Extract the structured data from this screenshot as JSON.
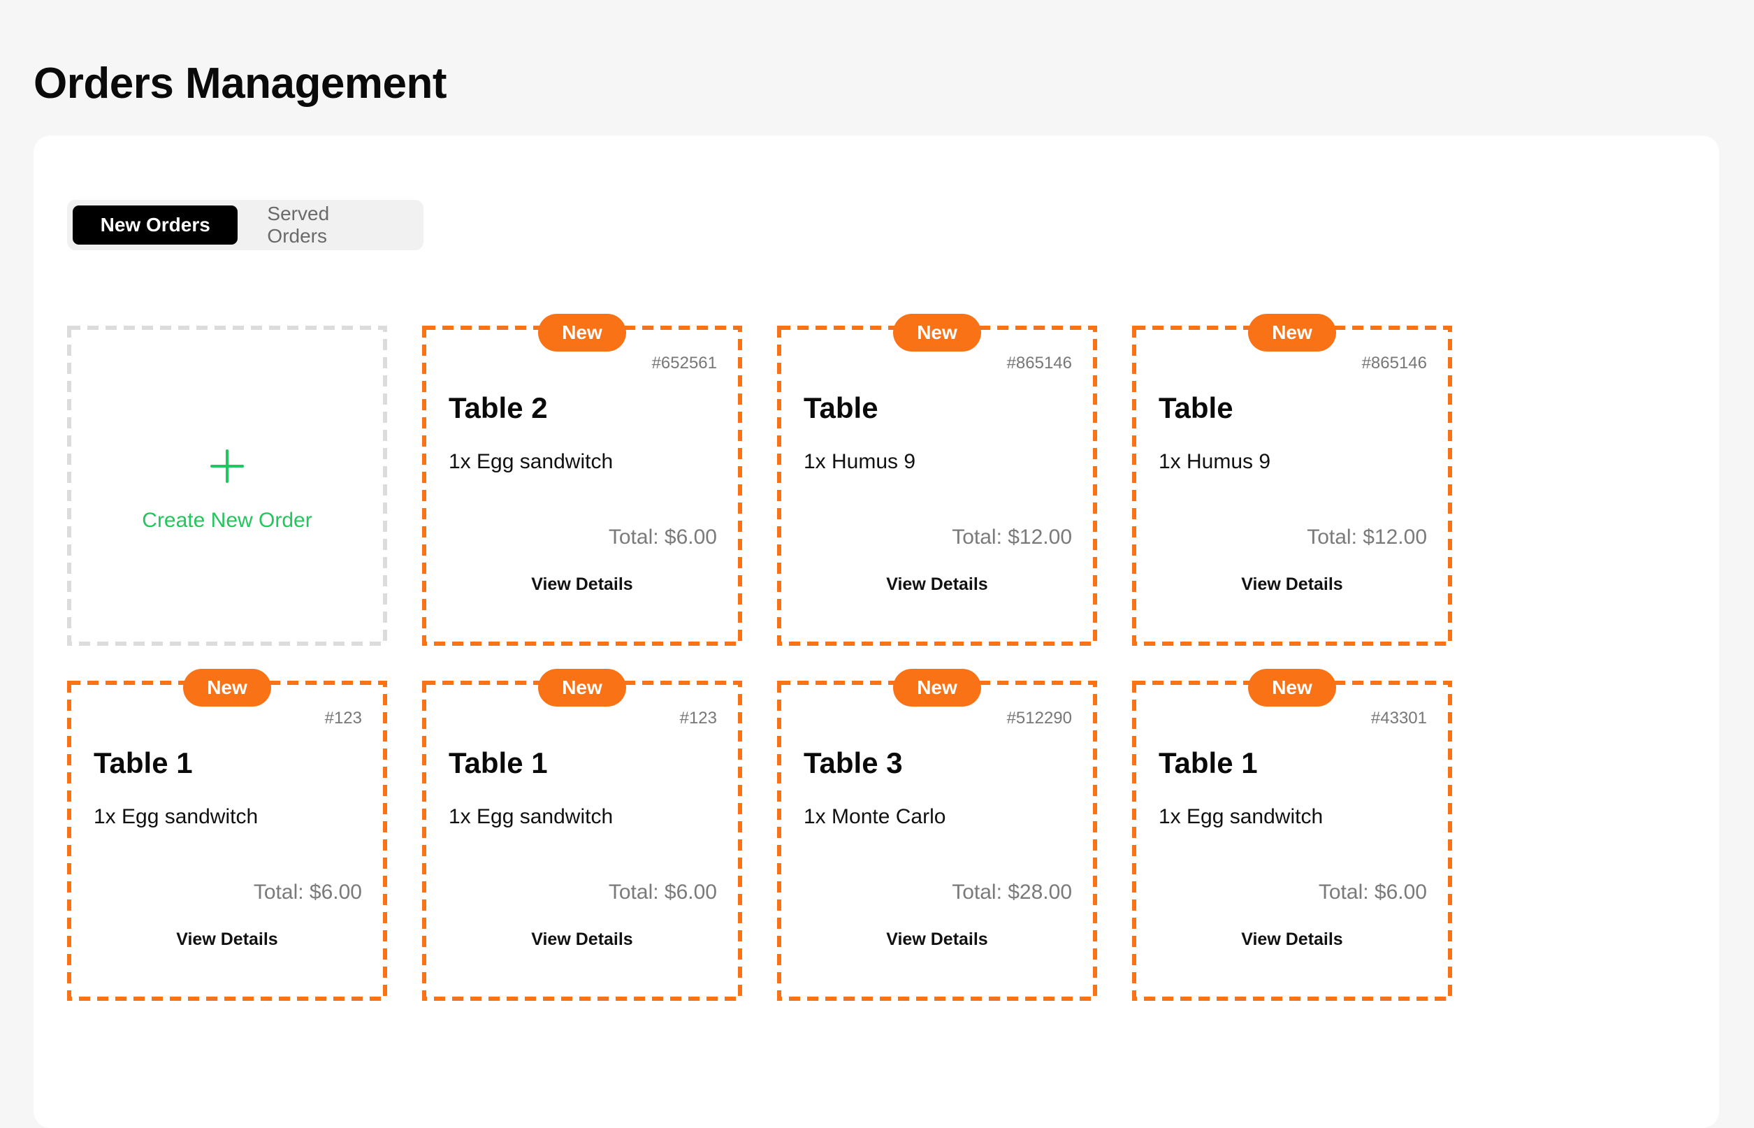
{
  "page": {
    "title": "Orders Management"
  },
  "tabs": [
    {
      "label": "New Orders",
      "active": true
    },
    {
      "label": "Served Orders",
      "active": false
    }
  ],
  "create_card": {
    "label": "Create New Order",
    "icon": "plus-icon"
  },
  "view_details_label": "View Details",
  "badge_label": "New",
  "colors": {
    "accent": "#f97316",
    "create": "#22c55e",
    "create_border": "#dcdcdc"
  },
  "orders": [
    {
      "badge": "New",
      "order_id": "#652561",
      "table": "Table 2",
      "item": "1x Egg sandwitch",
      "total": "Total: $6.00",
      "action": "View Details"
    },
    {
      "badge": "New",
      "order_id": "#865146",
      "table": "Table",
      "item": "1x Humus 9",
      "total": "Total: $12.00",
      "action": "View Details"
    },
    {
      "badge": "New",
      "order_id": "#865146",
      "table": "Table",
      "item": "1x Humus 9",
      "total": "Total: $12.00",
      "action": "View Details"
    },
    {
      "badge": "New",
      "order_id": "#123",
      "table": "Table 1",
      "item": "1x Egg sandwitch",
      "total": "Total: $6.00",
      "action": "View Details"
    },
    {
      "badge": "New",
      "order_id": "#123",
      "table": "Table 1",
      "item": "1x Egg sandwitch",
      "total": "Total: $6.00",
      "action": "View Details"
    },
    {
      "badge": "New",
      "order_id": "#512290",
      "table": "Table 3",
      "item": "1x Monte Carlo",
      "total": "Total: $28.00",
      "action": "View Details"
    },
    {
      "badge": "New",
      "order_id": "#43301",
      "table": "Table 1",
      "item": "1x Egg sandwitch",
      "total": "Total: $6.00",
      "action": "View Details"
    }
  ]
}
